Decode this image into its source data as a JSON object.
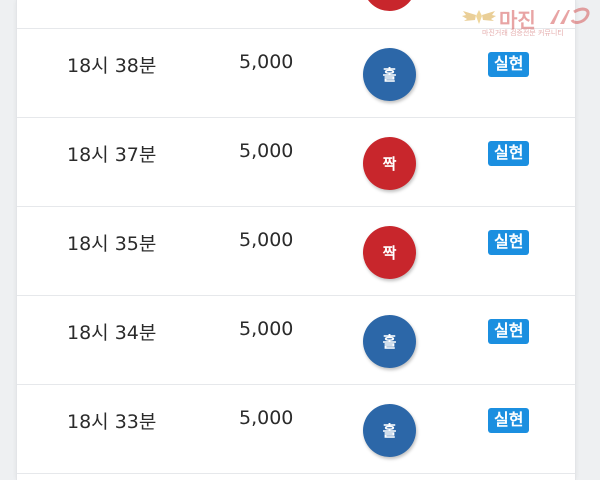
{
  "watermark": {
    "name": "마진",
    "tagline": "마진거래 검증전문 커뮤니티",
    "colors": {
      "logo": "#d65a5a"
    }
  },
  "colors": {
    "odd_ball": "#2c67a8",
    "even_ball": "#c8262c",
    "badge": "#1b8fe0"
  },
  "rows": [
    {
      "time": "18시 38분",
      "amount": "5,000",
      "result": "홀",
      "result_type": "odd",
      "status": "실현"
    },
    {
      "time": "18시 37분",
      "amount": "5,000",
      "result": "짝",
      "result_type": "even",
      "status": "실현"
    },
    {
      "time": "18시 35분",
      "amount": "5,000",
      "result": "짝",
      "result_type": "even",
      "status": "실현"
    },
    {
      "time": "18시 34분",
      "amount": "5,000",
      "result": "홀",
      "result_type": "odd",
      "status": "실현"
    },
    {
      "time": "18시 33분",
      "amount": "5,000",
      "result": "홀",
      "result_type": "odd",
      "status": "실현"
    }
  ]
}
